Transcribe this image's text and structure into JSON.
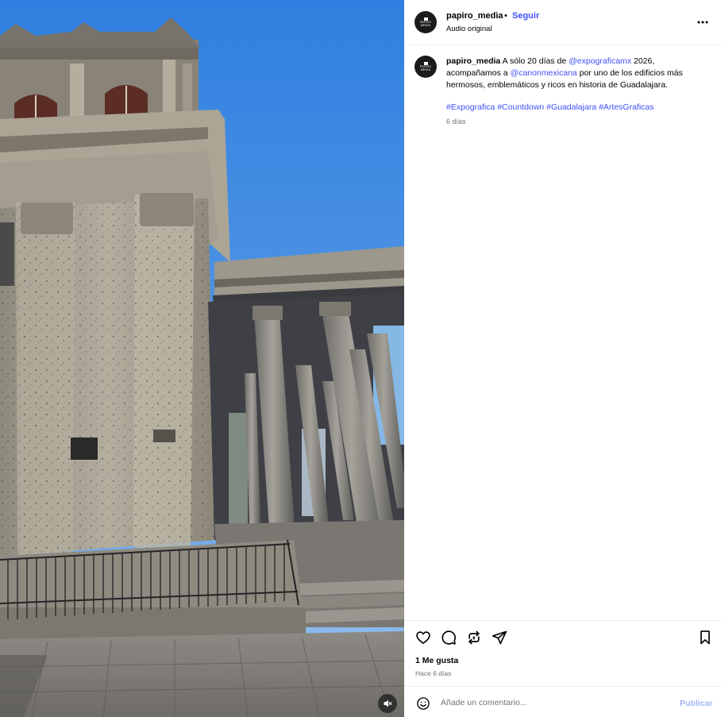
{
  "post": {
    "username": "papiro_media",
    "avatar_logo_text": "PAPIRO MEDIA",
    "separator": "•",
    "follow_label": "Seguir",
    "audio_label": "Audio original",
    "more_icon": "more-horizontal-icon"
  },
  "caption": {
    "username": "papiro_media",
    "part1": " A sólo 20 días de ",
    "mention1": "@expograficamx",
    "part2": " 2026, acompañamos a ",
    "mention2": "@canonmexicana",
    "part3": " por uno de los edificios más hermosos, emblemáticos y ricos en historia de Guadalajara.",
    "hashtags": [
      "#Expografica",
      "#Countdown",
      "#Guadalajara",
      "#ArtesGraficas"
    ],
    "time": "6 días"
  },
  "actions": {
    "icons": [
      "heart-icon",
      "comment-icon",
      "share-icon",
      "send-icon",
      "bookmark-icon"
    ],
    "likes": "1 Me gusta",
    "posted_ago": "Hace 6 días"
  },
  "comment": {
    "placeholder": "Añade un comentario...",
    "publish_label": "Publicar"
  },
  "media": {
    "mute_icon": "volume-muted-icon",
    "colors": {
      "sky": "#4a8ee0",
      "stone": "#a8a294",
      "shadow": "#3a3c40"
    }
  }
}
